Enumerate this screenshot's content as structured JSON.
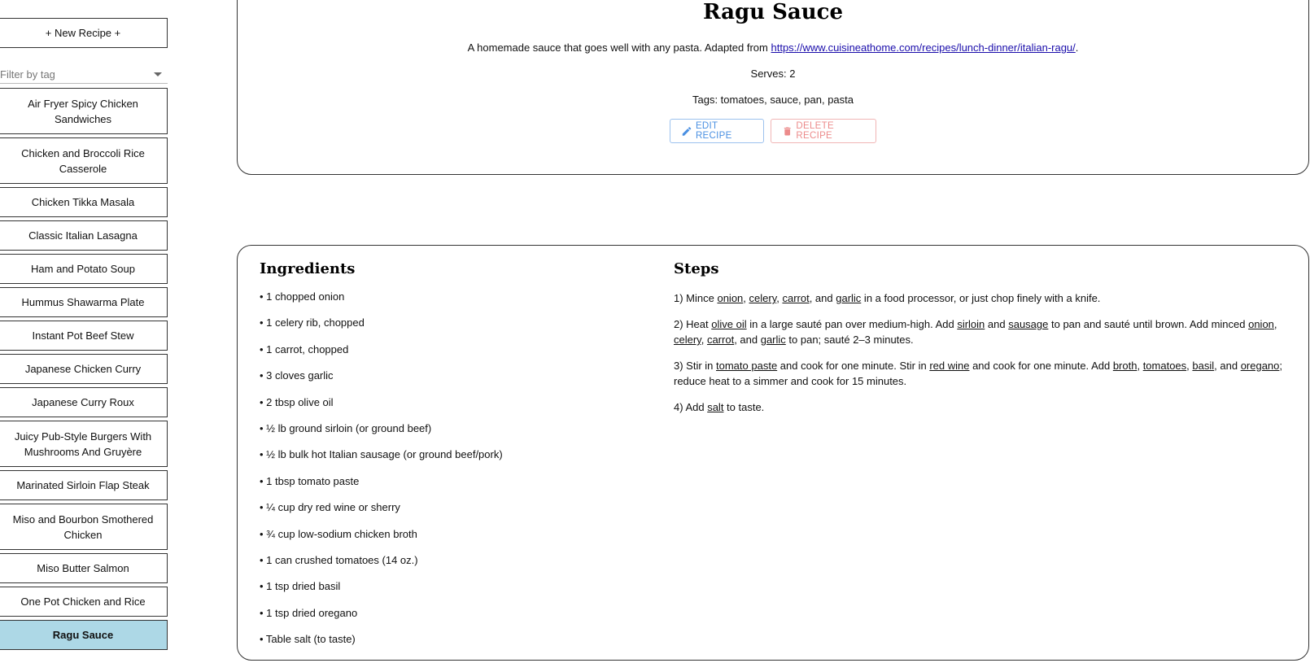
{
  "sidebar": {
    "new_recipe_label": "+ New Recipe +",
    "filter_placeholder": "Filter by tag",
    "items": [
      {
        "label": "Air Fryer Spicy Chicken Sandwiches",
        "lines": 2
      },
      {
        "label": "Chicken and Broccoli Rice Casserole",
        "lines": 2
      },
      {
        "label": "Chicken Tikka Masala",
        "lines": 1
      },
      {
        "label": "Classic Italian Lasagna",
        "lines": 1
      },
      {
        "label": "Ham and Potato Soup",
        "lines": 1
      },
      {
        "label": "Hummus Shawarma Plate",
        "lines": 1
      },
      {
        "label": "Instant Pot Beef Stew",
        "lines": 1
      },
      {
        "label": "Japanese Chicken Curry",
        "lines": 1
      },
      {
        "label": "Japanese Curry Roux",
        "lines": 1
      },
      {
        "label": "Juicy Pub-Style Burgers With Mushrooms And Gruyère",
        "lines": 2
      },
      {
        "label": "Marinated Sirloin Flap Steak",
        "lines": 1
      },
      {
        "label": "Miso and Bourbon Smothered Chicken",
        "lines": 2
      },
      {
        "label": "Miso Butter Salmon",
        "lines": 1
      },
      {
        "label": "One Pot Chicken and Rice",
        "lines": 1
      },
      {
        "label": "Ragu Sauce",
        "lines": 1,
        "active": true
      }
    ]
  },
  "recipe": {
    "title": "Ragu Sauce",
    "description_prefix": "A homemade sauce that goes well with any pasta. Adapted from ",
    "source_link": "https://www.cuisineathome.com/recipes/lunch-dinner/italian-ragu/",
    "description_suffix": ".",
    "serves": "Serves: 2",
    "tags": "Tags: tomatoes, sauce, pan, pasta",
    "edit_label": "EDIT RECIPE",
    "delete_label": "DELETE RECIPE"
  },
  "ingredients": {
    "title": "Ingredients",
    "items": [
      "• 1 chopped onion",
      "• 1 celery rib, chopped",
      "• 1 carrot, chopped",
      "• 3 cloves garlic",
      "• 2 tbsp olive oil",
      "• ½ lb ground sirloin (or ground beef)",
      "• ½ lb bulk hot Italian sausage (or ground beef/pork)",
      "• 1 tbsp tomato paste",
      "• ¼ cup dry red wine or sherry",
      "• ¾ cup low-sodium chicken broth",
      "• 1 can crushed tomatoes (14 oz.)",
      "• 1 tsp dried basil",
      "• 1 tsp dried oregano",
      "• Table salt (to taste)"
    ]
  },
  "steps": {
    "title": "Steps",
    "items": [
      [
        {
          "t": "1) Mince "
        },
        {
          "t": "onion",
          "u": true
        },
        {
          "t": ", "
        },
        {
          "t": "celery",
          "u": true
        },
        {
          "t": ", "
        },
        {
          "t": "carrot",
          "u": true
        },
        {
          "t": ", and "
        },
        {
          "t": "garlic",
          "u": true
        },
        {
          "t": " in a food processor, or just chop finely with a knife."
        }
      ],
      [
        {
          "t": "2) Heat "
        },
        {
          "t": "olive oil",
          "u": true
        },
        {
          "t": " in a large sauté pan over medium-high. Add "
        },
        {
          "t": "sirloin",
          "u": true
        },
        {
          "t": " and "
        },
        {
          "t": "sausage",
          "u": true
        },
        {
          "t": " to pan and sauté until brown. Add minced "
        },
        {
          "t": "onion",
          "u": true
        },
        {
          "t": ", "
        },
        {
          "t": "celery",
          "u": true
        },
        {
          "t": ", "
        },
        {
          "t": "carrot",
          "u": true
        },
        {
          "t": ", and "
        },
        {
          "t": "garlic",
          "u": true
        },
        {
          "t": " to pan; sauté 2–3 minutes."
        }
      ],
      [
        {
          "t": "3) Stir in "
        },
        {
          "t": "tomato paste",
          "u": true
        },
        {
          "t": " and cook for one minute. Stir in "
        },
        {
          "t": "red wine",
          "u": true
        },
        {
          "t": " and cook for one minute. Add "
        },
        {
          "t": "broth",
          "u": true
        },
        {
          "t": ", "
        },
        {
          "t": "tomatoes",
          "u": true
        },
        {
          "t": ", "
        },
        {
          "t": "basil",
          "u": true
        },
        {
          "t": ", and "
        },
        {
          "t": "oregano",
          "u": true
        },
        {
          "t": "; reduce heat to a simmer and cook for 15 minutes."
        }
      ],
      [
        {
          "t": "4) Add "
        },
        {
          "t": "salt",
          "u": true
        },
        {
          "t": " to taste."
        }
      ]
    ]
  },
  "colors": {
    "active_item": "#add8e6",
    "edit_accent": "#4a90e2",
    "delete_accent": "#ec8b8b",
    "link": "#1a0dab"
  },
  "icons": {
    "edit": "pencil-icon",
    "delete": "trash-icon",
    "filter": "chevron-down-icon"
  }
}
